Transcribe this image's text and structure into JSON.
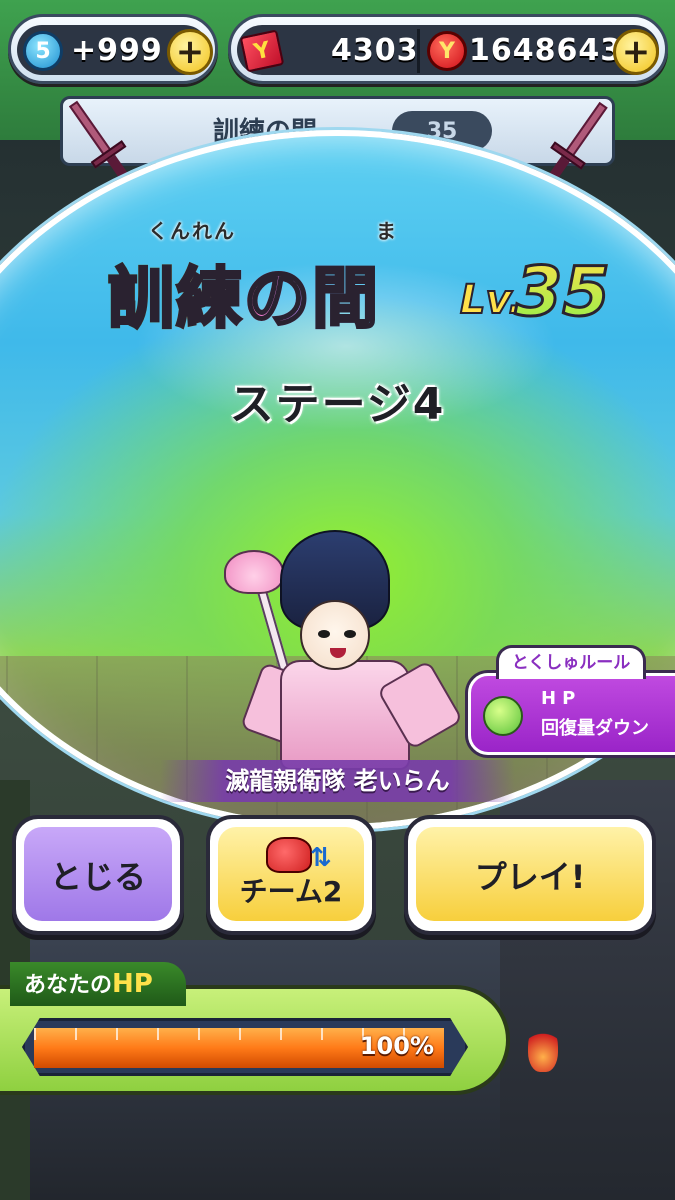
{
  "hud": {
    "stamina_level": "5",
    "stamina_value": "+999",
    "tickets": "4303",
    "money": "1648643",
    "ticket_icon": "y-card-icon",
    "money_icon": "y-money-icon"
  },
  "header": {
    "ruby_1": "くんれん",
    "ruby_2": "ま",
    "title": "訓練の間",
    "lv_label": "Lv.",
    "level": "35",
    "stage": "ステージ4"
  },
  "character": {
    "name": "滅龍親衛隊 老いらん"
  },
  "special_rule": {
    "tab": "とくしゅルール",
    "line1": "HP",
    "line2": "回復量ダウン"
  },
  "buttons": {
    "close": "とじる",
    "team": "チーム2",
    "play": "プレイ!"
  },
  "hp": {
    "title_prefix": "あなたの",
    "title_accent": "HP",
    "percent_text": "100%",
    "percent": 1.0
  },
  "colors": {
    "accent_purple": "#9a24c8",
    "button_yellow": "#f7cf3c",
    "button_purple": "#9f78e8",
    "hp_fill": "#ff7a18"
  }
}
